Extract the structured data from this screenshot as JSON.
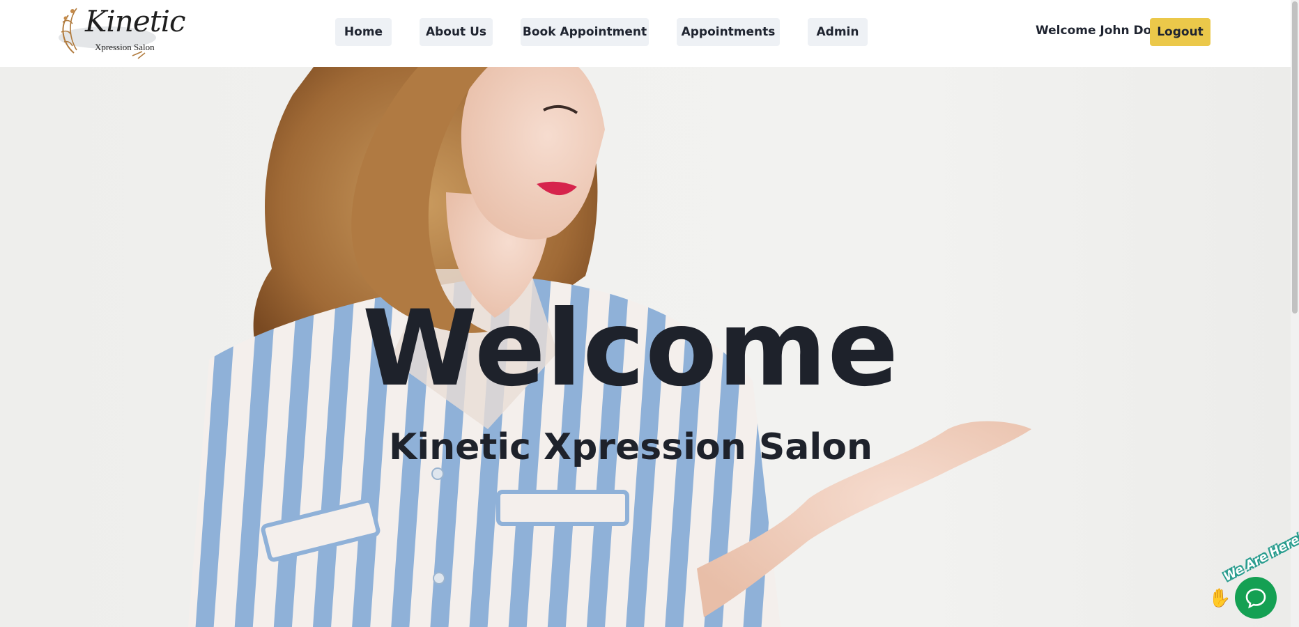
{
  "brand": {
    "name": "Kinetic",
    "tagline": "Xpression Salon"
  },
  "nav": {
    "items": [
      {
        "label": "Home"
      },
      {
        "label": "About Us"
      },
      {
        "label": "Book Appointment"
      },
      {
        "label": "Appointments"
      },
      {
        "label": "Admin"
      }
    ]
  },
  "user": {
    "greeting": "Welcome John Doe",
    "logout_label": "Logout"
  },
  "hero": {
    "title": "Welcome",
    "subtitle": "Kinetic Xpression Salon"
  },
  "chat": {
    "tag": "We Are Here!",
    "hand_icon": "waving-hand-icon",
    "bubble_icon": "chat-bubble-icon"
  },
  "colors": {
    "logout_accent": "#ebc84a",
    "nav_button_bg": "#eef1f5",
    "text_dark": "#1e222b",
    "chat_green": "#14a053"
  }
}
